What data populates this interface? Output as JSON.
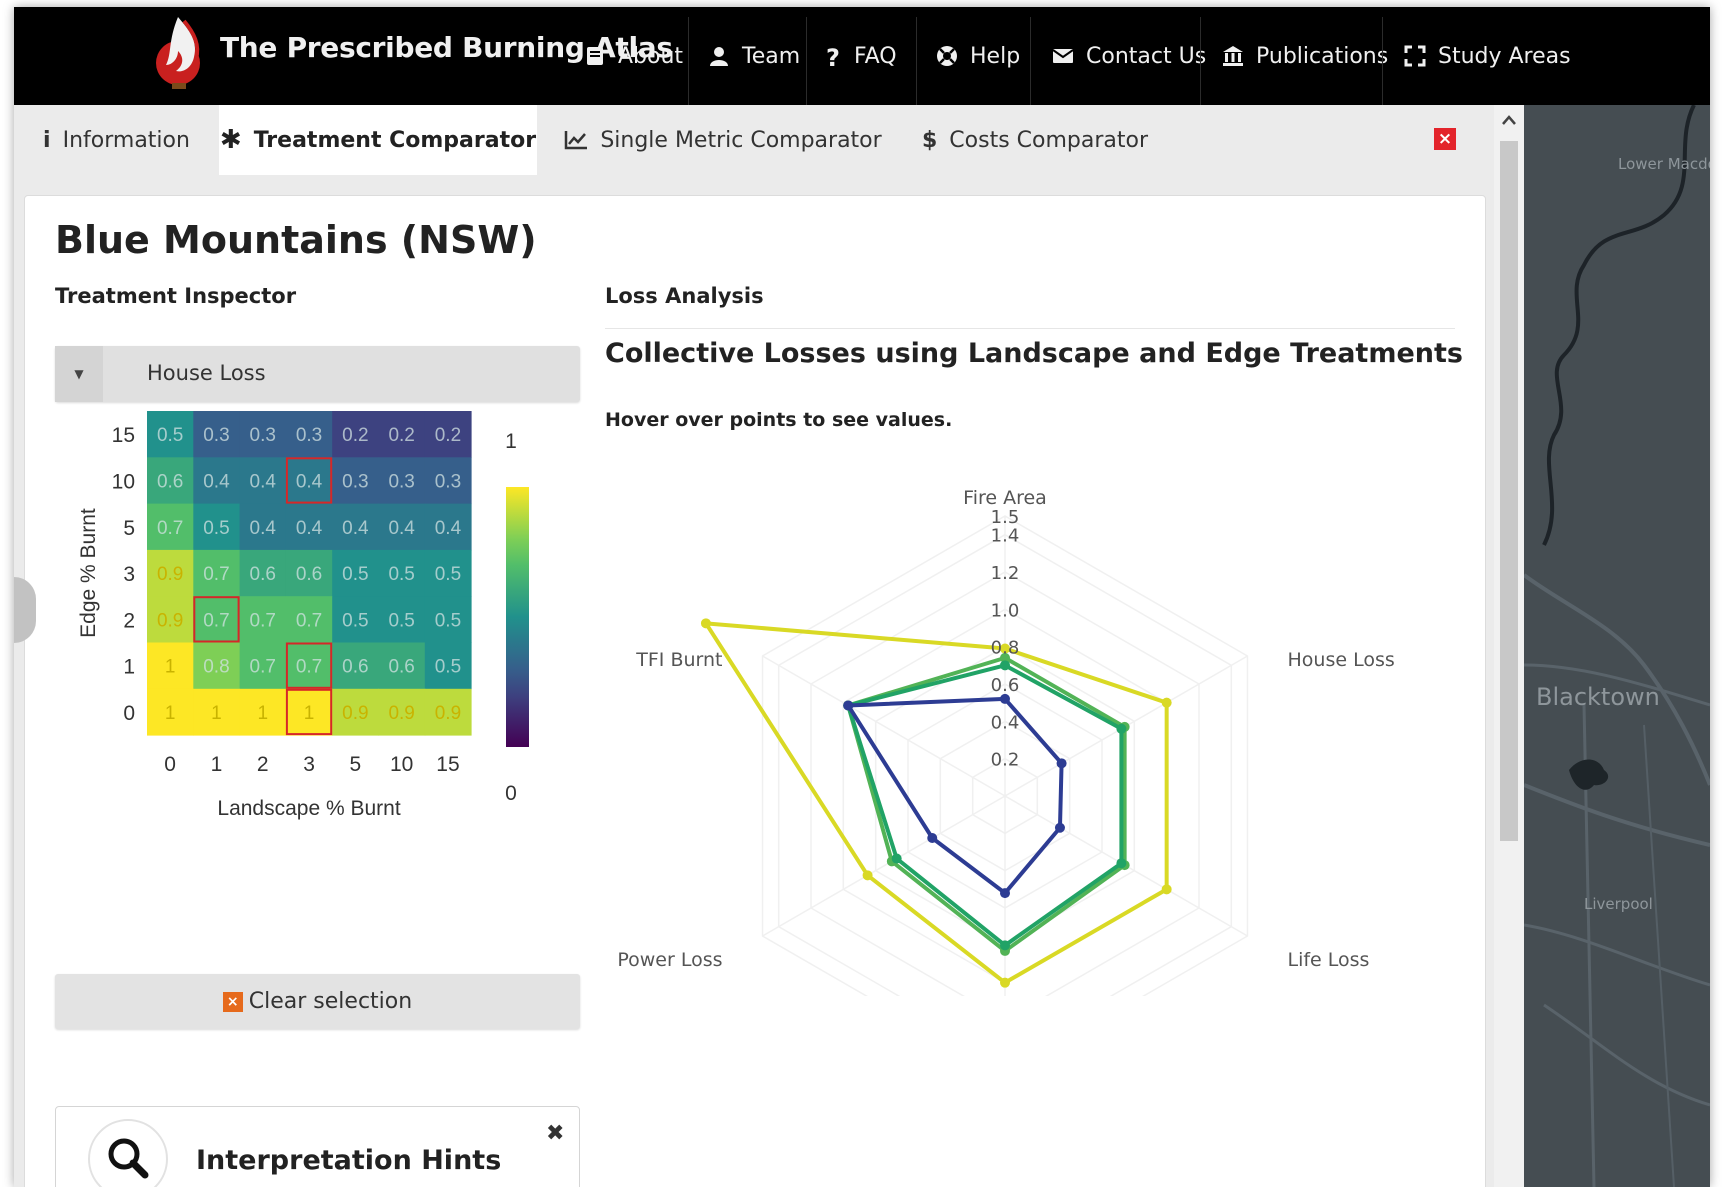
{
  "app": {
    "brand": "The Prescribed Burning Atlas",
    "nav": [
      {
        "label": "About",
        "icon": "book-icon"
      },
      {
        "label": "Team",
        "icon": "user-icon"
      },
      {
        "label": "FAQ",
        "icon": "question-icon"
      },
      {
        "label": "Help",
        "icon": "lifebuoy-icon"
      },
      {
        "label": "Contact Us",
        "icon": "envelope-icon"
      },
      {
        "label": "Publications",
        "icon": "institution-icon"
      },
      {
        "label": "Study Areas",
        "icon": "expand-icon"
      }
    ]
  },
  "tabs": [
    {
      "label": "Information",
      "icon": "info-icon"
    },
    {
      "label": "Treatment Comparator",
      "icon": "asterisk-icon",
      "active": true
    },
    {
      "label": "Single Metric Comparator",
      "icon": "line-chart-icon"
    },
    {
      "label": "Costs Comparator",
      "icon": "dollar-icon"
    }
  ],
  "page": {
    "title": "Blue Mountains (NSW)",
    "left_heading": "Treatment Inspector",
    "right_heading": "Loss Analysis",
    "metric_select": "House Loss",
    "clear_label": "Clear selection",
    "hints_title": "Interpretation Hints"
  },
  "map": {
    "labels": [
      "Lower Macdonald",
      "Blacktown",
      "Liverpool"
    ]
  },
  "colors": {
    "nav_bg": "#000000",
    "accent_red": "#e3242b",
    "clear_icon": "#e66a1c",
    "selection_outline": "#d62728"
  },
  "chart_data": [
    {
      "type": "heatmap",
      "xlabel": "Landscape % Burnt",
      "ylabel": "Edge % Burnt",
      "x_categories": [
        "0",
        "1",
        "2",
        "3",
        "5",
        "10",
        "15"
      ],
      "y_categories": [
        "15",
        "10",
        "5",
        "3",
        "2",
        "1",
        "0"
      ],
      "values": [
        [
          0.5,
          0.3,
          0.3,
          0.3,
          0.2,
          0.2,
          0.2
        ],
        [
          0.6,
          0.4,
          0.4,
          0.4,
          0.3,
          0.3,
          0.3
        ],
        [
          0.7,
          0.5,
          0.4,
          0.4,
          0.4,
          0.4,
          0.4
        ],
        [
          0.9,
          0.7,
          0.6,
          0.6,
          0.5,
          0.5,
          0.5
        ],
        [
          0.9,
          0.7,
          0.7,
          0.7,
          0.5,
          0.5,
          0.5
        ],
        [
          1,
          0.8,
          0.7,
          0.7,
          0.6,
          0.6,
          0.5
        ],
        [
          1,
          1,
          1,
          1,
          0.9,
          0.9,
          0.9
        ]
      ],
      "selected_cells": [
        {
          "edge": "10",
          "landscape": "3"
        },
        {
          "edge": "2",
          "landscape": "1"
        },
        {
          "edge": "1",
          "landscape": "3"
        },
        {
          "edge": "0",
          "landscape": "3"
        }
      ],
      "colorbar": {
        "min_label": "0",
        "max_label": "1",
        "colormap": "viridis"
      }
    },
    {
      "type": "radar",
      "title": "Collective Losses using Landscape and Edge Treatments",
      "subtitle": "Hover over points to see values.",
      "axes": [
        "Fire Area",
        "House Loss",
        "Life Loss",
        "",
        "Power Loss",
        "TFI Burnt"
      ],
      "radial_ticks": [
        "0.2",
        "0.4",
        "0.6",
        "0.8",
        "1.0",
        "1.2",
        "1.4",
        "1.5"
      ],
      "range": [
        0,
        1.5
      ],
      "series": [
        {
          "color": "#d9d925",
          "values": [
            0.79,
            1.0,
            1.0,
            1.0,
            0.85,
            1.85
          ]
        },
        {
          "color": "#52b356",
          "values": [
            0.74,
            0.74,
            0.74,
            0.83,
            0.7,
            0.97
          ]
        },
        {
          "color": "#21a366",
          "values": [
            0.7,
            0.72,
            0.72,
            0.8,
            0.67,
            0.97
          ]
        },
        {
          "color": "#2d3c93",
          "values": [
            0.52,
            0.35,
            0.34,
            0.52,
            0.45,
            0.97
          ]
        }
      ]
    }
  ]
}
